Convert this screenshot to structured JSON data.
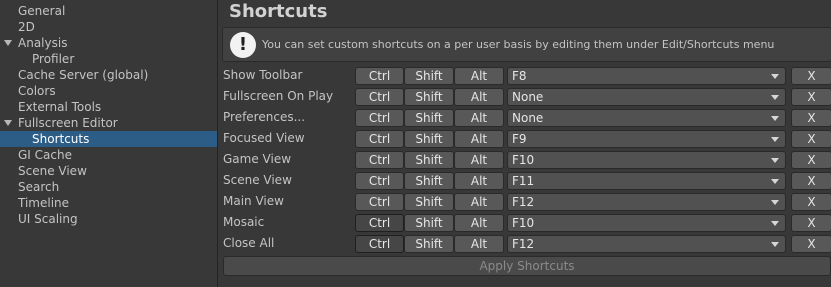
{
  "sidebar": {
    "items": [
      {
        "label": "General"
      },
      {
        "label": "2D"
      },
      {
        "label": "Analysis"
      },
      {
        "label": "Profiler"
      },
      {
        "label": "Cache Server (global)"
      },
      {
        "label": "Colors"
      },
      {
        "label": "External Tools"
      },
      {
        "label": "Fullscreen Editor"
      },
      {
        "label": "Shortcuts"
      },
      {
        "label": "GI Cache"
      },
      {
        "label": "Scene View"
      },
      {
        "label": "Search"
      },
      {
        "label": "Timeline"
      },
      {
        "label": "UI Scaling"
      }
    ],
    "selected": "Shortcuts"
  },
  "main": {
    "title": "Shortcuts",
    "help_text": "You can set custom shortcuts on a per user basis by editing them under Edit/Shortcuts menu",
    "help_icon": "!",
    "modifier_labels": {
      "ctrl": "Ctrl",
      "shift": "Shift",
      "alt": "Alt"
    },
    "clear_label": "X",
    "rows": [
      {
        "label": "Show Toolbar",
        "key": "F8"
      },
      {
        "label": "Fullscreen On Play",
        "key": "None"
      },
      {
        "label": "Preferences...",
        "key": "None"
      },
      {
        "label": "Focused View",
        "key": "F9"
      },
      {
        "label": "Game View",
        "key": "F10"
      },
      {
        "label": "Scene View",
        "key": "F11"
      },
      {
        "label": "Main View",
        "key": "F12"
      },
      {
        "label": "Mosaic",
        "key": "F10",
        "ctrl_active": true
      },
      {
        "label": "Close All",
        "key": "F12",
        "ctrl_active": true
      }
    ],
    "apply_label": "Apply Shortcuts"
  },
  "colors": {
    "background": "#383838",
    "selection": "#2c5d87",
    "button": "#585858"
  }
}
